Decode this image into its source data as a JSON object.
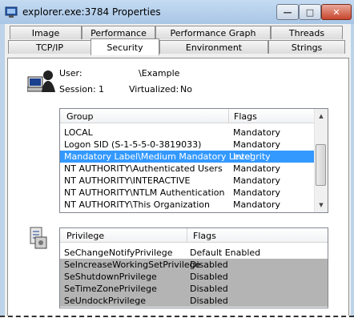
{
  "window": {
    "title": "explorer.exe:3784 Properties"
  },
  "tabs_row1": [
    {
      "label": "Image"
    },
    {
      "label": "Performance"
    },
    {
      "label": "Performance Graph"
    },
    {
      "label": "Threads"
    }
  ],
  "tabs_row2": [
    {
      "label": "TCP/IP"
    },
    {
      "label": "Security"
    },
    {
      "label": "Environment"
    },
    {
      "label": "Strings"
    }
  ],
  "security": {
    "user_label": "User:",
    "user_value": "\\Example",
    "session_label": "Session:",
    "session_value": "1",
    "virtualized_label": "Virtualized:",
    "virtualized_value": "No"
  },
  "groups": {
    "col_group": "Group",
    "col_flags": "Flags",
    "rows": [
      {
        "group": "LOCAL",
        "flags": "Mandatory"
      },
      {
        "group": "Logon SID (S-1-5-5-0-3819033)",
        "flags": "Mandatory"
      },
      {
        "group": "Mandatory Label\\Medium Mandatory Level",
        "flags": "Integrity"
      },
      {
        "group": "NT AUTHORITY\\Authenticated Users",
        "flags": "Mandatory"
      },
      {
        "group": "NT AUTHORITY\\INTERACTIVE",
        "flags": "Mandatory"
      },
      {
        "group": "NT AUTHORITY\\NTLM Authentication",
        "flags": "Mandatory"
      },
      {
        "group": "NT AUTHORITY\\This Organization",
        "flags": "Mandatory"
      }
    ]
  },
  "privileges": {
    "col_privilege": "Privilege",
    "col_flags": "Flags",
    "rows": [
      {
        "privilege": "SeChangeNotifyPrivilege",
        "flags": "Default Enabled"
      },
      {
        "privilege": "SeIncreaseWorkingSetPrivilege",
        "flags": "Disabled"
      },
      {
        "privilege": "SeShutdownPrivilege",
        "flags": "Disabled"
      },
      {
        "privilege": "SeTimeZonePrivilege",
        "flags": "Disabled"
      },
      {
        "privilege": "SeUndockPrivilege",
        "flags": "Disabled"
      }
    ]
  },
  "colors": {
    "selection": "#3399ff",
    "disabled_row": "#b4b4b4",
    "title_bar": "#bcd3ea"
  }
}
